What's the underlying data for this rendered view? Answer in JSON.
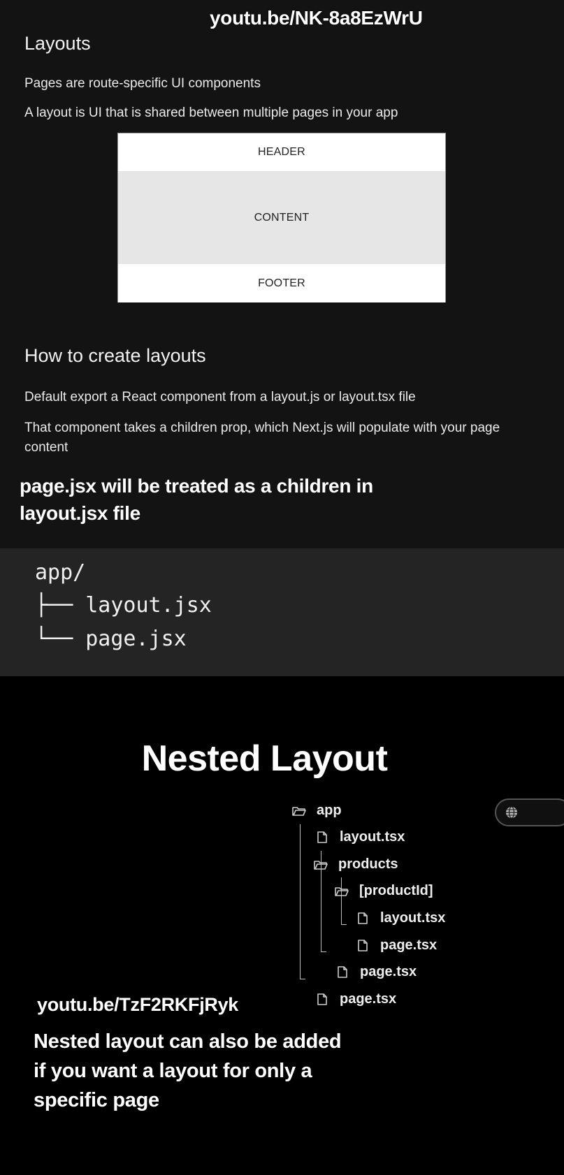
{
  "slide1": {
    "video_link": "youtu.be/NK-8a8EzWrU",
    "heading": "Layouts",
    "line1": "Pages are route-specific UI components",
    "line2": "A layout is UI that is shared between multiple pages in your app",
    "diagram": {
      "header": "HEADER",
      "content": "CONTENT",
      "footer": "FOOTER"
    },
    "heading2": "How to create layouts",
    "line3": "Default export a React component from a layout.js or layout.tsx file",
    "line4": "That component takes a children prop, which Next.js will populate with your page content",
    "caption": "page.jsx will be treated as a children in layout.jsx file"
  },
  "code_tree": {
    "line1": "app/",
    "line2": "├── layout.jsx",
    "line3": "└── page.jsx"
  },
  "slide2": {
    "title": "Nested Layout",
    "tree": {
      "app": "app",
      "layout_root": "layout.tsx",
      "products": "products",
      "product_id": "[productId]",
      "layout_product": "layout.tsx",
      "page_product": "page.tsx",
      "page_products": "page.tsx",
      "page_root": "page.tsx"
    },
    "video_link": "youtu.be/TzF2RKFjRyk",
    "caption": "Nested layout can also be added if you want a layout for only a specific page"
  }
}
